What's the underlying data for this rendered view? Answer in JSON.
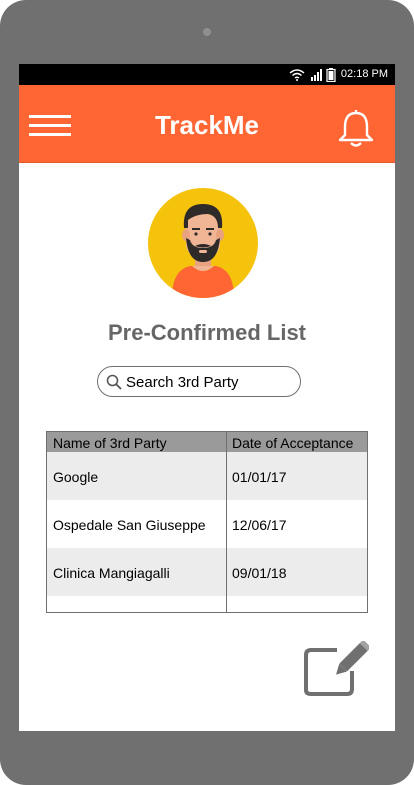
{
  "statusbar": {
    "time": "02:18 PM"
  },
  "appbar": {
    "title": "TrackMe"
  },
  "page": {
    "title": "Pre-Confirmed List"
  },
  "search": {
    "placeholder": "Search 3rd Party"
  },
  "table": {
    "headers": [
      "Name of 3rd Party",
      "Date of Acceptance"
    ],
    "rows": [
      {
        "name": "Google",
        "date": "01/01/17"
      },
      {
        "name": "Ospedale San Giuseppe",
        "date": "12/06/17"
      },
      {
        "name": "Clinica Mangiagalli",
        "date": "09/01/18"
      }
    ]
  },
  "colors": {
    "accent": "#FF6633",
    "avatar_bg": "#F5C20C",
    "device_frame": "#707070",
    "header_row": "#9A9A9A",
    "alt_row": "#ECECEC"
  },
  "icons": [
    "wifi-icon",
    "signal-icon",
    "battery-icon",
    "hamburger-menu-icon",
    "bell-icon",
    "avatar",
    "search-icon",
    "edit-icon"
  ]
}
